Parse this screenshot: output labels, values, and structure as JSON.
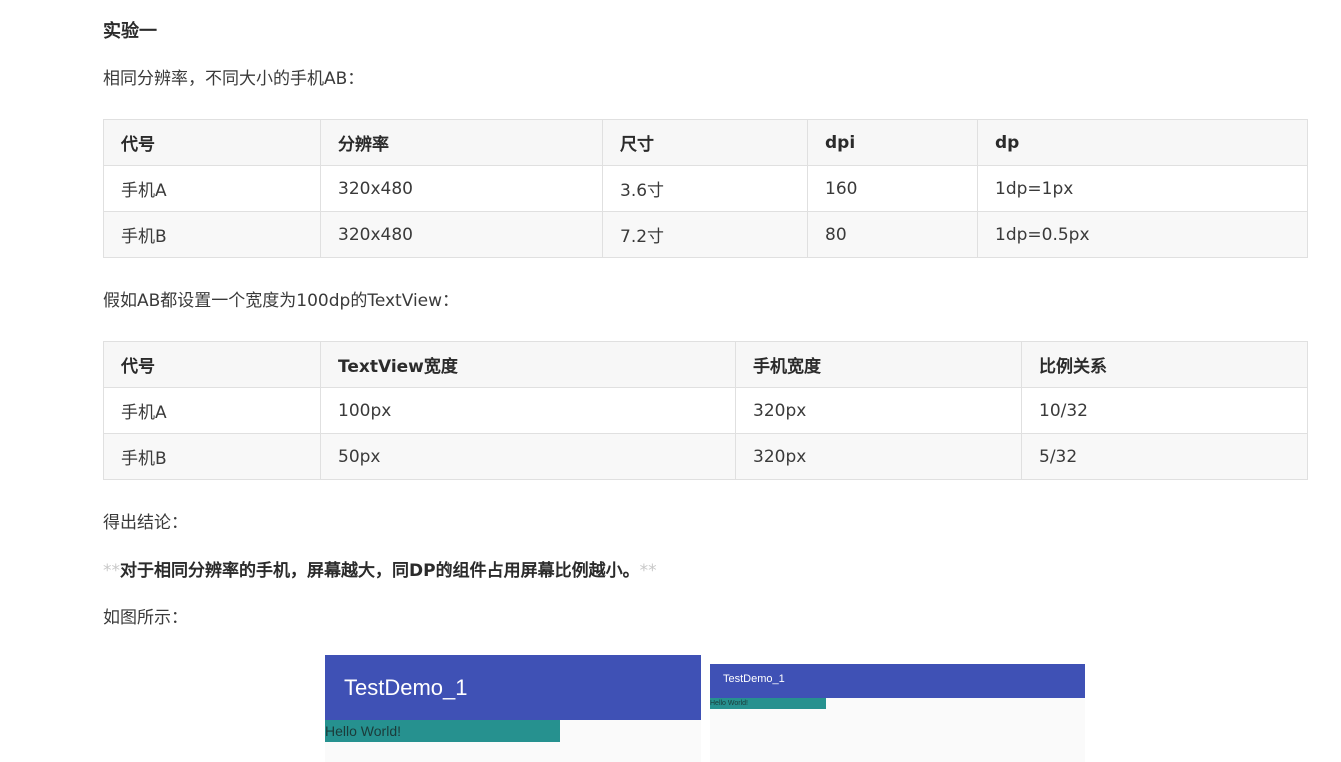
{
  "heading": "实验一",
  "intro_1": "相同分辨率，不同大小的手机AB：",
  "table_1": {
    "headers": [
      "代号",
      "分辨率",
      "尺寸",
      "dpi",
      "dp"
    ],
    "rows": [
      [
        "手机A",
        "320x480",
        "3.6寸",
        "160",
        "1dp=1px"
      ],
      [
        "手机B",
        "320x480",
        "7.2寸",
        "80",
        "1dp=0.5px"
      ]
    ]
  },
  "intro_2": "假如AB都设置一个宽度为100dp的TextView：",
  "table_2": {
    "headers": [
      "代号",
      "TextView宽度",
      "手机宽度",
      "比例关系"
    ],
    "rows": [
      [
        "手机A",
        "100px",
        "320px",
        "10/32"
      ],
      [
        "手机B",
        "50px",
        "320px",
        "5/32"
      ]
    ]
  },
  "conclusion_label": "得出结论：",
  "conclusion": {
    "stars_open": "**",
    "text": "对于相同分辨率的手机，屏幕越大，同DP的组件占用屏幕比例越小。",
    "stars_close": "**"
  },
  "figure_label": "如图所示：",
  "demo_a": {
    "title": "TestDemo_1",
    "textview": "Hello World!"
  },
  "demo_b": {
    "title": "TestDemo_1",
    "textview": "Hello World!"
  },
  "colors": {
    "toolbar": "#3f51b5",
    "textview_bg": "#26918f"
  }
}
